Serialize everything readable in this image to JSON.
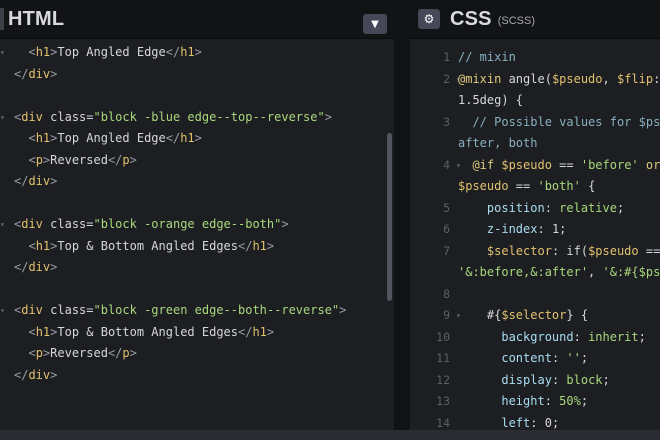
{
  "html_panel": {
    "title": "HTML",
    "collapse_icon": "chevron-down-icon",
    "lines": [
      {
        "fold": "▾",
        "segments": [
          [
            "  ",
            "t-text"
          ],
          [
            "<",
            "t-punc"
          ],
          [
            "h1",
            "t-tag"
          ],
          [
            ">",
            "t-punc"
          ],
          [
            "Top Angled Edge",
            "t-text"
          ],
          [
            "</",
            "t-punc"
          ],
          [
            "h1",
            "t-tag"
          ],
          [
            ">",
            "t-punc"
          ]
        ]
      },
      {
        "fold": "",
        "segments": [
          [
            "</",
            "t-punc"
          ],
          [
            "div",
            "t-tag"
          ],
          [
            ">",
            "t-punc"
          ]
        ]
      },
      {
        "fold": "",
        "segments": []
      },
      {
        "fold": "▾",
        "segments": [
          [
            "<",
            "t-punc"
          ],
          [
            "div ",
            "t-tag"
          ],
          [
            "class=",
            "t-attr"
          ],
          [
            "\"block -blue edge--top--reverse\"",
            "t-str"
          ],
          [
            ">",
            "t-punc"
          ]
        ]
      },
      {
        "fold": "",
        "segments": [
          [
            "  ",
            "t-text"
          ],
          [
            "<",
            "t-punc"
          ],
          [
            "h1",
            "t-tag"
          ],
          [
            ">",
            "t-punc"
          ],
          [
            "Top Angled Edge",
            "t-text"
          ],
          [
            "</",
            "t-punc"
          ],
          [
            "h1",
            "t-tag"
          ],
          [
            ">",
            "t-punc"
          ]
        ]
      },
      {
        "fold": "",
        "segments": [
          [
            "  ",
            "t-text"
          ],
          [
            "<",
            "t-punc"
          ],
          [
            "p",
            "t-tag"
          ],
          [
            ">",
            "t-punc"
          ],
          [
            "Reversed",
            "t-text"
          ],
          [
            "</",
            "t-punc"
          ],
          [
            "p",
            "t-tag"
          ],
          [
            ">",
            "t-punc"
          ]
        ]
      },
      {
        "fold": "",
        "segments": [
          [
            "</",
            "t-punc"
          ],
          [
            "div",
            "t-tag"
          ],
          [
            ">",
            "t-punc"
          ]
        ]
      },
      {
        "fold": "",
        "segments": []
      },
      {
        "fold": "▾",
        "segments": [
          [
            "<",
            "t-punc"
          ],
          [
            "div ",
            "t-tag"
          ],
          [
            "class=",
            "t-attr"
          ],
          [
            "\"block -orange edge--both\"",
            "t-str"
          ],
          [
            ">",
            "t-punc"
          ]
        ]
      },
      {
        "fold": "",
        "segments": [
          [
            "  ",
            "t-text"
          ],
          [
            "<",
            "t-punc"
          ],
          [
            "h1",
            "t-tag"
          ],
          [
            ">",
            "t-punc"
          ],
          [
            "Top & Bottom Angled Edges",
            "t-text"
          ],
          [
            "</",
            "t-punc"
          ],
          [
            "h1",
            "t-tag"
          ],
          [
            ">",
            "t-punc"
          ]
        ]
      },
      {
        "fold": "",
        "segments": [
          [
            "</",
            "t-punc"
          ],
          [
            "div",
            "t-tag"
          ],
          [
            ">",
            "t-punc"
          ]
        ]
      },
      {
        "fold": "",
        "segments": []
      },
      {
        "fold": "▾",
        "segments": [
          [
            "<",
            "t-punc"
          ],
          [
            "div ",
            "t-tag"
          ],
          [
            "class=",
            "t-attr"
          ],
          [
            "\"block -green edge--both--reverse\"",
            "t-str"
          ],
          [
            ">",
            "t-punc"
          ]
        ]
      },
      {
        "fold": "",
        "segments": [
          [
            "  ",
            "t-text"
          ],
          [
            "<",
            "t-punc"
          ],
          [
            "h1",
            "t-tag"
          ],
          [
            ">",
            "t-punc"
          ],
          [
            "Top & Bottom Angled Edges",
            "t-text"
          ],
          [
            "</",
            "t-punc"
          ],
          [
            "h1",
            "t-tag"
          ],
          [
            ">",
            "t-punc"
          ]
        ]
      },
      {
        "fold": "",
        "segments": [
          [
            "  ",
            "t-text"
          ],
          [
            "<",
            "t-punc"
          ],
          [
            "p",
            "t-tag"
          ],
          [
            ">",
            "t-punc"
          ],
          [
            "Reversed",
            "t-text"
          ],
          [
            "</",
            "t-punc"
          ],
          [
            "p",
            "t-tag"
          ],
          [
            ">",
            "t-punc"
          ]
        ]
      },
      {
        "fold": "",
        "segments": [
          [
            "</",
            "t-punc"
          ],
          [
            "div",
            "t-tag"
          ],
          [
            ">",
            "t-punc"
          ]
        ]
      }
    ]
  },
  "css_panel": {
    "title": "CSS",
    "subtitle": "(SCSS)",
    "settings_icon": "gear-icon",
    "lines": [
      {
        "num": "1",
        "fold": "",
        "segments": [
          [
            "// mixin",
            "t-cmt"
          ]
        ]
      },
      {
        "num": "2",
        "fold": "▾",
        "segments": [
          [
            "@mixin ",
            "t-at"
          ],
          [
            "angle(",
            "t-text"
          ],
          [
            "$pseudo",
            "t-var"
          ],
          [
            ", ",
            "t-text"
          ],
          [
            "$flip",
            "t-var"
          ],
          [
            ": ",
            "t-text"
          ]
        ]
      },
      {
        "num": "",
        "fold": "",
        "segments": [
          [
            "1.5deg) {",
            "t-text"
          ]
        ]
      },
      {
        "num": "3",
        "fold": "",
        "segments": [
          [
            "  // Possible values for $ps",
            "t-cmt"
          ]
        ]
      },
      {
        "num": "",
        "fold": "",
        "segments": [
          [
            "after, both",
            "t-cmt"
          ]
        ]
      },
      {
        "num": "4",
        "fold": "▾",
        "segments": [
          [
            "  ",
            "t-text"
          ],
          [
            "@if ",
            "t-kw"
          ],
          [
            "$pseudo",
            "t-var"
          ],
          [
            " == ",
            "t-text"
          ],
          [
            "'before'",
            "t-val"
          ],
          [
            " or",
            "t-kw"
          ]
        ]
      },
      {
        "num": "",
        "fold": "",
        "segments": [
          [
            "$pseudo",
            "t-var"
          ],
          [
            " == ",
            "t-text"
          ],
          [
            "'both'",
            "t-val"
          ],
          [
            " {",
            "t-text"
          ]
        ]
      },
      {
        "num": "5",
        "fold": "",
        "segments": [
          [
            "    ",
            "t-text"
          ],
          [
            "position",
            "t-prop"
          ],
          [
            ": ",
            "t-text"
          ],
          [
            "relative",
            "t-val"
          ],
          [
            ";",
            "t-text"
          ]
        ]
      },
      {
        "num": "6",
        "fold": "",
        "segments": [
          [
            "    ",
            "t-text"
          ],
          [
            "z-index",
            "t-prop"
          ],
          [
            ": ",
            "t-text"
          ],
          [
            "1",
            "t-num"
          ],
          [
            ";",
            "t-text"
          ]
        ]
      },
      {
        "num": "7",
        "fold": "",
        "segments": [
          [
            "    ",
            "t-text"
          ],
          [
            "$selector",
            "t-var"
          ],
          [
            ": if(",
            "t-text"
          ],
          [
            "$pseudo",
            "t-var"
          ],
          [
            " ==",
            "t-text"
          ]
        ]
      },
      {
        "num": "",
        "fold": "",
        "segments": [
          [
            "'&:before,&:after'",
            "t-val"
          ],
          [
            ", ",
            "t-text"
          ],
          [
            "'&:#{$ps",
            "t-val"
          ]
        ]
      },
      {
        "num": "8",
        "fold": "",
        "segments": []
      },
      {
        "num": "9",
        "fold": "▾",
        "segments": [
          [
            "    #{",
            "t-text"
          ],
          [
            "$selector",
            "t-var"
          ],
          [
            "} {",
            "t-text"
          ]
        ]
      },
      {
        "num": "10",
        "fold": "",
        "segments": [
          [
            "      ",
            "t-text"
          ],
          [
            "background",
            "t-prop"
          ],
          [
            ": ",
            "t-text"
          ],
          [
            "inherit",
            "t-val"
          ],
          [
            ";",
            "t-text"
          ]
        ]
      },
      {
        "num": "11",
        "fold": "",
        "segments": [
          [
            "      ",
            "t-text"
          ],
          [
            "content",
            "t-prop"
          ],
          [
            ": ",
            "t-text"
          ],
          [
            "''",
            "t-val"
          ],
          [
            ";",
            "t-text"
          ]
        ]
      },
      {
        "num": "12",
        "fold": "",
        "segments": [
          [
            "      ",
            "t-text"
          ],
          [
            "display",
            "t-prop"
          ],
          [
            ": ",
            "t-text"
          ],
          [
            "block",
            "t-val"
          ],
          [
            ";",
            "t-text"
          ]
        ]
      },
      {
        "num": "13",
        "fold": "",
        "segments": [
          [
            "      ",
            "t-text"
          ],
          [
            "height",
            "t-prop"
          ],
          [
            ": ",
            "t-text"
          ],
          [
            "50%",
            "t-val"
          ],
          [
            ";",
            "t-text"
          ]
        ]
      },
      {
        "num": "14",
        "fold": "",
        "segments": [
          [
            "      ",
            "t-text"
          ],
          [
            "left",
            "t-prop"
          ],
          [
            ": ",
            "t-text"
          ],
          [
            "0",
            "t-num"
          ],
          [
            ";",
            "t-text"
          ]
        ]
      }
    ]
  }
}
